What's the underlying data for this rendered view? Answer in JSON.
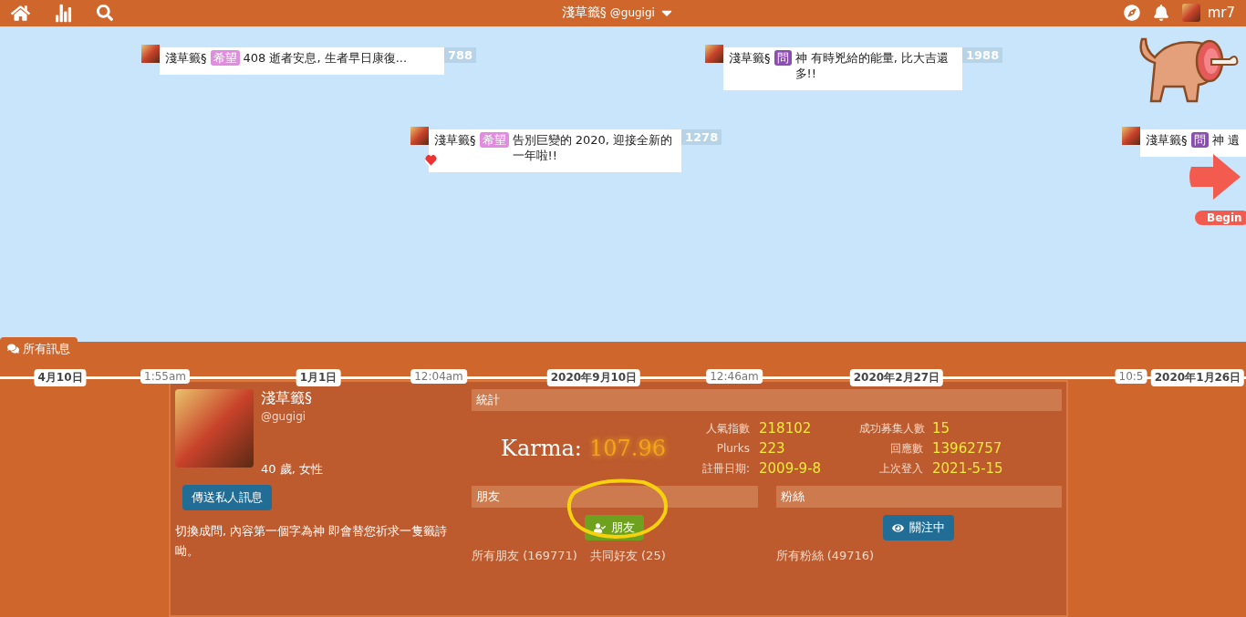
{
  "header": {
    "title": "淺草籤§",
    "handle": "@gugigi",
    "user": "mr7"
  },
  "plurks": [
    {
      "name": "淺草籤§",
      "qualifier": "希望",
      "color": "#e28be0",
      "text": "408 逝者安息, 生者早日康復...",
      "responses": "788",
      "liked": false
    },
    {
      "name": "淺草籤§",
      "qualifier": "問",
      "color": "#8a4fb0",
      "text": "神 有時兇給的能量, 比大吉還多!!",
      "responses": "1988",
      "liked": false
    },
    {
      "name": "淺草籤§",
      "qualifier": "希望",
      "color": "#e28be0",
      "text": "告別巨變的 2020, 迎接全新的一年啦!!",
      "responses": "1278",
      "liked": true
    },
    {
      "name": "淺草籤§",
      "qualifier": "問",
      "color": "#8a4fb0",
      "text": "神 遺",
      "liked": false
    }
  ],
  "begin_label": "Begin",
  "all_messages": "所有訊息",
  "timeline_labels": [
    {
      "text": "4月10日",
      "kind": "date"
    },
    {
      "text": "1:55am",
      "kind": "time"
    },
    {
      "text": "1月1日",
      "kind": "date"
    },
    {
      "text": "12:04am",
      "kind": "time"
    },
    {
      "text": "2020年9月10日",
      "kind": "date"
    },
    {
      "text": "12:46am",
      "kind": "time"
    },
    {
      "text": "2020年2月27日",
      "kind": "date"
    },
    {
      "text": "10:5",
      "kind": "time"
    },
    {
      "text": "2020年1月26日",
      "kind": "date"
    }
  ],
  "profile": {
    "name": "淺草籤§",
    "handle": "@gugigi",
    "age_gender": "40 歲, 女性",
    "message_button": "傳送私人訊息",
    "bio": "切換成問, 內容第一個字為神 即會替您祈求一隻籤詩呦。"
  },
  "stats": {
    "title": "統計",
    "karma_label": "Karma:",
    "karma_value": "107.96",
    "rows": [
      {
        "label": "人氣指數",
        "value": "218102"
      },
      {
        "label": "成功募集人數",
        "value": "15"
      },
      {
        "label": "Plurks",
        "value": "223"
      },
      {
        "label": "回應數",
        "value": "13962757"
      },
      {
        "label": "註冊日期:",
        "value": "2009-9-8"
      },
      {
        "label": "上次登入",
        "value": "2021-5-15"
      }
    ]
  },
  "friends": {
    "title": "朋友",
    "button": "朋友",
    "links": [
      "所有朋友 (169771)",
      "共同好友 (25)"
    ]
  },
  "fans": {
    "title": "粉絲",
    "button": "關注中",
    "links": [
      "所有粉絲 (49716)"
    ]
  }
}
